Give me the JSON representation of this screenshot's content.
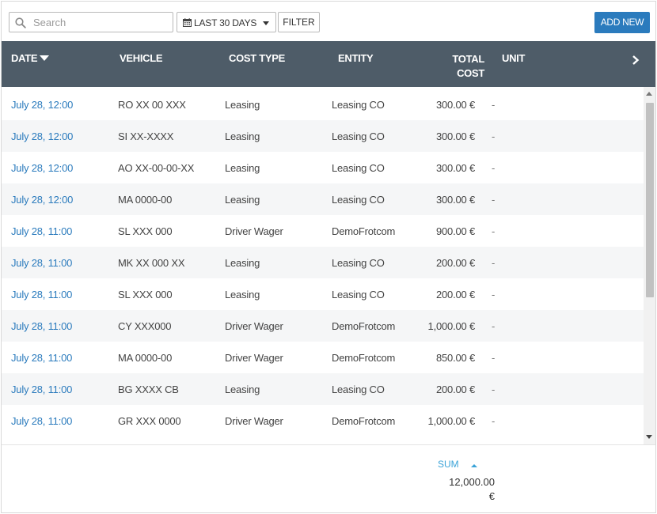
{
  "toolbar": {
    "search_placeholder": "Search",
    "search_value": "",
    "date_range": "LAST 30 DAYS",
    "filter_label": "FILTER",
    "add_new_label": "ADD NEW"
  },
  "colors": {
    "header_bg": "#4e5c68",
    "accent": "#2b7bbd",
    "link": "#2b7bbd",
    "sum_label": "#3aa3d8",
    "row_alt": "#f5f6f7"
  },
  "table": {
    "columns": {
      "date": "DATE",
      "vehicle": "VEHICLE",
      "cost_type": "COST TYPE",
      "entity": "ENTITY",
      "total_cost_line1": "TOTAL",
      "total_cost_line2": "COST",
      "unit": "UNIT"
    },
    "sort_column": "date",
    "rows": [
      {
        "date": "July 28, 12:00",
        "vehicle": "RO XX 00 XXX",
        "cost_type": "Leasing",
        "entity": "Leasing CO",
        "total": "300.00 €",
        "unit": "-"
      },
      {
        "date": "July 28, 12:00",
        "vehicle": "SI XX-XXXX",
        "cost_type": "Leasing",
        "entity": "Leasing CO",
        "total": "300.00 €",
        "unit": "-"
      },
      {
        "date": "July 28, 12:00",
        "vehicle": "AO XX-00-00-XX",
        "cost_type": "Leasing",
        "entity": "Leasing CO",
        "total": "300.00 €",
        "unit": "-"
      },
      {
        "date": "July 28, 12:00",
        "vehicle": "MA 0000-00",
        "cost_type": "Leasing",
        "entity": "Leasing CO",
        "total": "300.00 €",
        "unit": "-"
      },
      {
        "date": "July 28, 11:00",
        "vehicle": "SL XXX 000",
        "cost_type": "Driver Wager",
        "entity": "DemoFrotcom",
        "total": "900.00 €",
        "unit": "-"
      },
      {
        "date": "July 28, 11:00",
        "vehicle": "MK XX 000 XX",
        "cost_type": "Leasing",
        "entity": "Leasing CO",
        "total": "200.00 €",
        "unit": "-"
      },
      {
        "date": "July 28, 11:00",
        "vehicle": "SL XXX 000",
        "cost_type": "Leasing",
        "entity": "Leasing CO",
        "total": "200.00 €",
        "unit": "-"
      },
      {
        "date": "July 28, 11:00",
        "vehicle": "CY XXX000",
        "cost_type": "Driver Wager",
        "entity": "DemoFrotcom",
        "total": "1,000.00 €",
        "unit": "-"
      },
      {
        "date": "July 28, 11:00",
        "vehicle": "MA 0000-00",
        "cost_type": "Driver Wager",
        "entity": "DemoFrotcom",
        "total": "850.00 €",
        "unit": "-"
      },
      {
        "date": "July 28, 11:00",
        "vehicle": "BG XXXX CB",
        "cost_type": "Leasing",
        "entity": "Leasing CO",
        "total": "200.00 €",
        "unit": "-"
      },
      {
        "date": "July 28, 11:00",
        "vehicle": "GR XXX 0000",
        "cost_type": "Driver Wager",
        "entity": "DemoFrotcom",
        "total": "1,000.00 €",
        "unit": "-"
      }
    ]
  },
  "footer": {
    "sum_label": "SUM",
    "sum_value_line1": "12,000.00",
    "sum_value_line2": "€"
  },
  "icons": {
    "search": "search-icon",
    "calendar": "calendar-icon",
    "dropdown": "caret-down-icon",
    "sort": "sort-desc-icon",
    "next_columns": "chevron-right-icon",
    "sum_toggle": "caret-up-icon"
  }
}
